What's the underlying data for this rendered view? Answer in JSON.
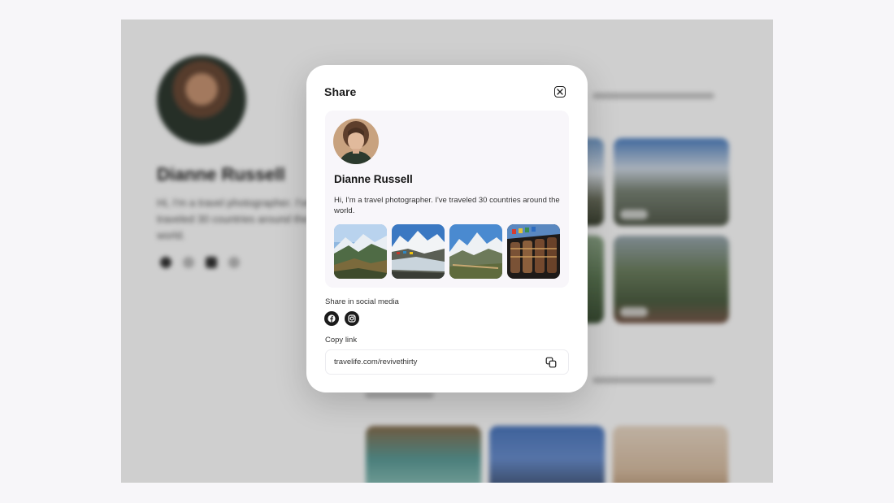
{
  "modal": {
    "title": "Share",
    "close_icon": "close-icon"
  },
  "profile": {
    "name": "Dianne Russell",
    "bio": "Hi, I'm a travel photographer. I've traveled 30 countries around the world.",
    "photos": [
      {
        "name": "mountain-valley-photo"
      },
      {
        "name": "snowy-peaks-river-photo"
      },
      {
        "name": "glacier-range-photo"
      },
      {
        "name": "prayer-wheels-photo"
      }
    ]
  },
  "share": {
    "social_label": "Share in social media",
    "networks": [
      {
        "name": "facebook",
        "icon": "facebook-icon"
      },
      {
        "name": "instagram",
        "icon": "instagram-icon"
      }
    ],
    "copy_label": "Copy link",
    "link": "travelife.com/revivethirty",
    "copy_icon": "copy-icon"
  },
  "background": {
    "name": "Dianne Russell",
    "bio": "Hi, I'm a travel photographer. I've traveled 30 countries around the world."
  },
  "colors": {
    "overlay": "#000000",
    "modal": "#ffffff",
    "preview": "#f8f6fa",
    "icon_dark": "#1b1b1b"
  }
}
